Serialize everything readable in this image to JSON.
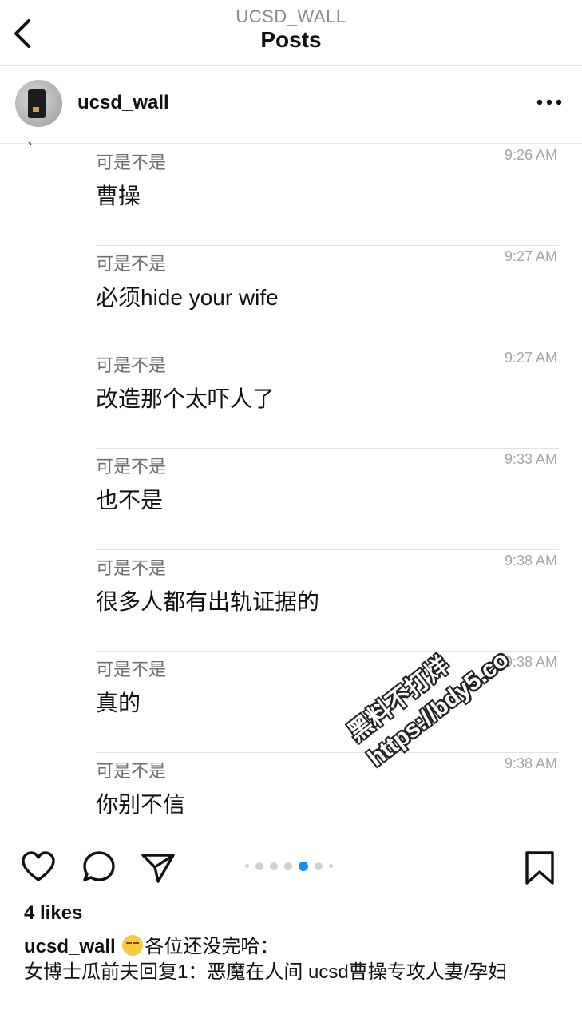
{
  "header": {
    "subtitle": "UCSD_WALL",
    "title": "Posts"
  },
  "post_user": {
    "username": "ucsd_wall"
  },
  "chat": [
    {
      "sender": "可是不是",
      "time": "9:26 AM",
      "text": "曹操"
    },
    {
      "sender": "可是不是",
      "time": "9:27 AM",
      "text": "必须hide your wife"
    },
    {
      "sender": "可是不是",
      "time": "9:27 AM",
      "text": "改造那个太吓人了"
    },
    {
      "sender": "可是不是",
      "time": "9:33 AM",
      "text": "也不是"
    },
    {
      "sender": "可是不是",
      "time": "9:38 AM",
      "text": "很多人都有出轨证据的"
    },
    {
      "sender": "可是不是",
      "time": "9:38 AM",
      "text": "真的"
    },
    {
      "sender": "可是不是",
      "time": "9:38 AM",
      "text": "你别不信"
    }
  ],
  "watermark": {
    "line1": "黑料不打烊",
    "line2": "https://bdy5.co"
  },
  "actions": {
    "icons": [
      "heart-icon",
      "comment-icon",
      "share-icon",
      "bookmark-icon"
    ]
  },
  "carousel": {
    "active_index": 3,
    "count": 7
  },
  "likes": "4 likes",
  "caption": {
    "username": "ucsd_wall",
    "emoji": "dizzy-face-emoji",
    "line1": "各位还没完哈：",
    "line2": "女博士瓜前夫回复1：恶魔在人间 ucsd曹操专攻人妻/孕妇"
  },
  "colors": {
    "accent": "#1a8cf0",
    "muted": "#8a8a8a",
    "divider": "#e2e2e2"
  }
}
